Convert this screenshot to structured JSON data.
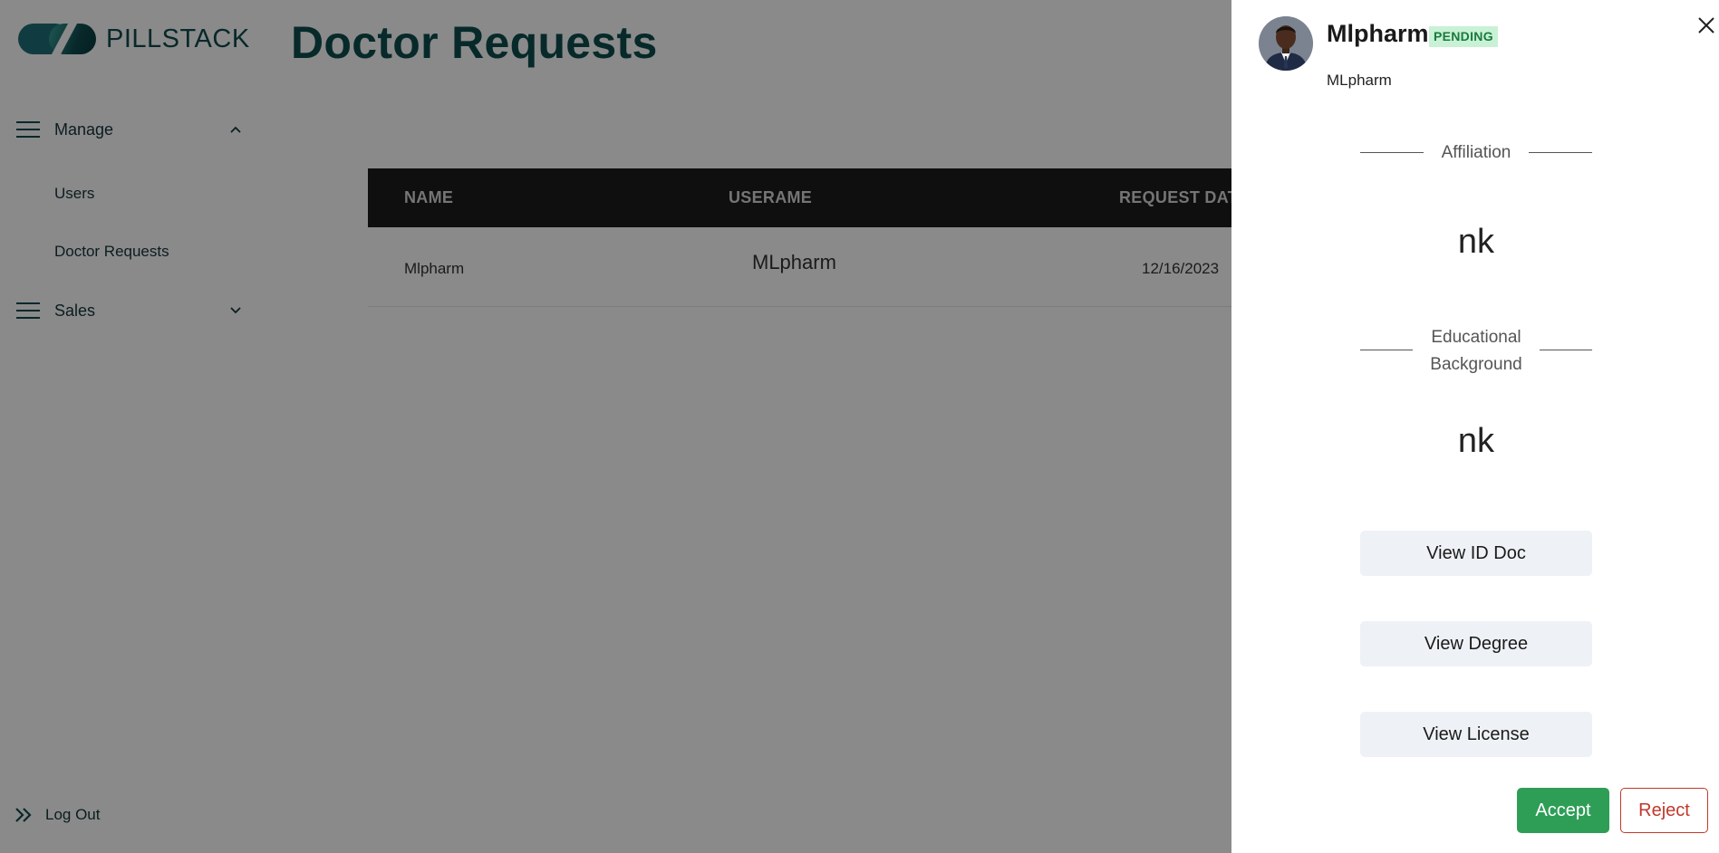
{
  "brand": {
    "name": "PILLSTACK"
  },
  "page": {
    "title": "Doctor Requests"
  },
  "sidebar": {
    "groups": [
      {
        "label": "Manage",
        "icon": "menu-icon",
        "expanded": true,
        "items": [
          {
            "label": "Users"
          },
          {
            "label": "Doctor Requests"
          }
        ]
      },
      {
        "label": "Sales",
        "icon": "menu-icon",
        "expanded": false,
        "items": []
      }
    ],
    "logout": {
      "label": "Log Out",
      "icon": "double-chevron-right-icon"
    }
  },
  "table": {
    "columns": [
      "NAME",
      "USERAME",
      "REQUEST DAT"
    ],
    "rows": [
      {
        "name": "Mlpharm",
        "username": "MLpharm",
        "request_date": "12/16/2023"
      }
    ]
  },
  "drawer": {
    "name": "Mlpharm",
    "status": "PENDING",
    "username": "MLpharm",
    "affiliation": {
      "title": "Affiliation",
      "value": "nk"
    },
    "education": {
      "title_line1": "Educational",
      "title_line2": "Background",
      "value": "nk"
    },
    "buttons": {
      "id_doc": "View ID Doc",
      "degree": "View Degree",
      "license": "View License",
      "accept": "Accept",
      "reject": "Reject"
    }
  },
  "colors": {
    "brand": "#0f4a4f",
    "title": "#0d4d4e",
    "table_header": "#1c1c1c",
    "pending_bg": "#c8f1d6",
    "pending_text": "#1a7a3c",
    "accept": "#2e9e57",
    "reject": "#c0392b",
    "doc_button": "#eef1f5"
  }
}
